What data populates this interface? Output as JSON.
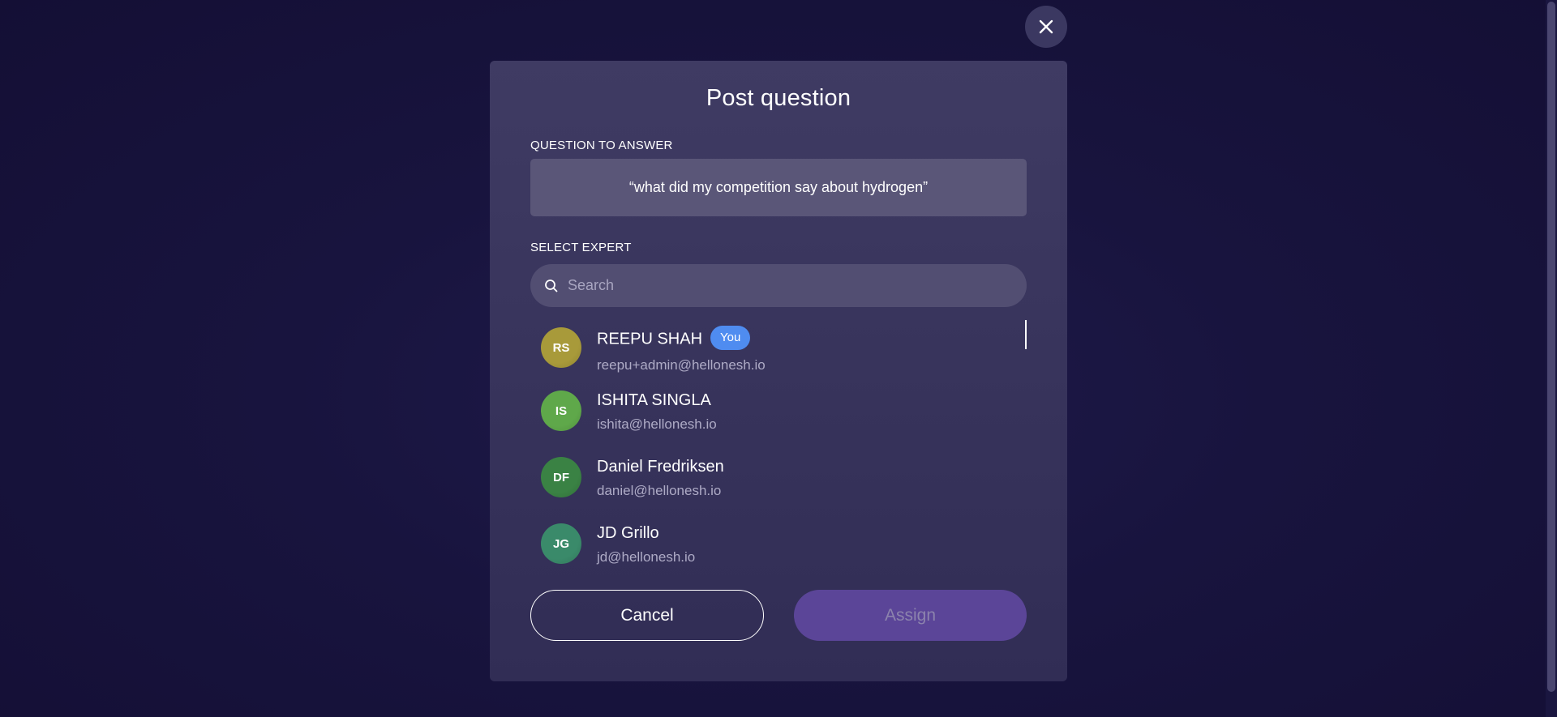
{
  "modal": {
    "title": "Post question",
    "question_label": "QUESTION TO ANSWER",
    "question_text": "“what did my competition say about hydrogen”",
    "expert_label": "SELECT EXPERT",
    "search": {
      "placeholder": "Search",
      "value": ""
    },
    "cancel_label": "Cancel",
    "assign_label": "Assign",
    "assign_disabled": true
  },
  "experts": [
    {
      "initials": "RS",
      "name": "REEPU SHAH",
      "email": "reepu+admin@hellonesh.io",
      "badge": "You",
      "avatar_color": "#a89a3a"
    },
    {
      "initials": "IS",
      "name": "ISHITA SINGLA",
      "email": "ishita@hellonesh.io",
      "badge": "",
      "avatar_color": "#5fa84a"
    },
    {
      "initials": "DF",
      "name": "Daniel Fredriksen",
      "email": "daniel@hellonesh.io",
      "badge": "",
      "avatar_color": "#3a8244"
    },
    {
      "initials": "JG",
      "name": "JD Grillo",
      "email": "jd@hellonesh.io",
      "badge": "",
      "avatar_color": "#3a8a6a"
    }
  ],
  "icons": {
    "close": "close-icon",
    "search": "search-icon"
  },
  "colors": {
    "background": "#16123a",
    "modal": "#3b3760",
    "badge": "#4f8cf0",
    "assign_button": "#5b4598"
  }
}
